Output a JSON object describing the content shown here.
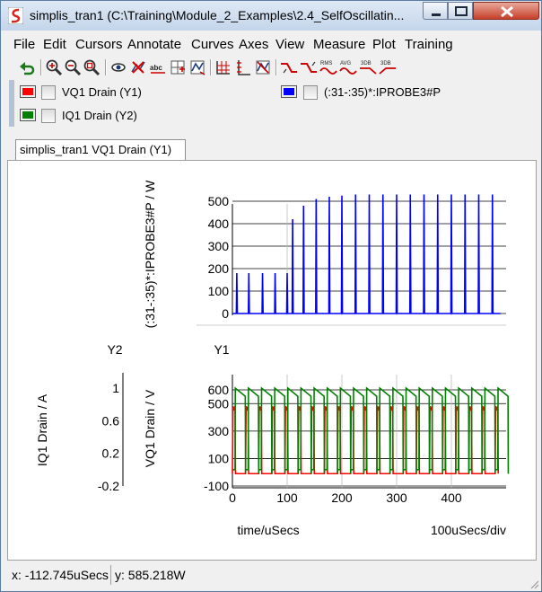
{
  "window": {
    "title": "simplis_tran1 (C:\\Training\\Module_2_Examples\\2.4_SelfOscillatin..."
  },
  "menu": [
    "File",
    "Edit",
    "Cursors",
    "Annotate",
    "Curves",
    "Axes",
    "View",
    "Measure",
    "Plot",
    "Training"
  ],
  "toolbar": {
    "icons": [
      "undo-icon",
      "zoom-in-icon",
      "zoom-out-icon",
      "zoom-fit-icon",
      "show-icon",
      "delete-icon",
      "abc-label-icon",
      "add-grid-icon",
      "add-curve-icon",
      "grid-icon",
      "split-icon",
      "fourier-icon",
      "rise-icon",
      "fall-icon",
      "rms-icon",
      "avg-icon",
      "3db-high-icon",
      "3db-low-icon"
    ],
    "labels": {
      "rms": "RMS",
      "avg": "AVG",
      "db1": "3DB",
      "db2": "3DB"
    }
  },
  "legend": {
    "items": [
      {
        "label": "VQ1 Drain (Y1)",
        "color": "#ff0000"
      },
      {
        "label": "IQ1 Drain (Y2)",
        "color": "#008000"
      },
      {
        "label": "(:31-:35)*:IPROBE3#P",
        "color": "#0000ff"
      }
    ]
  },
  "tabs": [
    {
      "label": "simplis_tran1 VQ1 Drain (Y1)"
    }
  ],
  "plot": {
    "top": {
      "ylabel": "(:31-:35)*:IPROBE3#P / W",
      "yticks": [
        "500",
        "400",
        "300",
        "200",
        "100",
        "0"
      ],
      "color": "#0000ff"
    },
    "bottom": {
      "y1_title": "Y1",
      "y2_title": "Y2",
      "y1_label": "VQ1 Drain / V",
      "y2_label": "IQ1 Drain / A",
      "y1_ticks": [
        "600",
        "500",
        "300",
        "100",
        "-100"
      ],
      "y2_ticks": [
        "1",
        "0.6",
        "0.2",
        "-0.2"
      ],
      "xticks": [
        "0",
        "100",
        "200",
        "300",
        "400"
      ],
      "xlabel": "time/uSecs",
      "xscale_label": "100uSecs/div",
      "colors": {
        "vdrain": "#ff0000",
        "idrain": "#008000"
      }
    }
  },
  "status": {
    "x": "x: -112.745uSecs",
    "y": "y: 585.218W"
  },
  "chart_data": [
    {
      "type": "line",
      "series": [
        {
          "name": "(:31-:35)*:IPROBE3#P",
          "points": [
            [
              0,
              0
            ],
            [
              8,
              180
            ],
            [
              30,
              180
            ],
            [
              55,
              180
            ],
            [
              78,
              180
            ],
            [
              100,
              180
            ],
            [
              110,
              420
            ],
            [
              130,
              480
            ],
            [
              153,
              510
            ],
            [
              177,
              520
            ],
            [
              200,
              525
            ],
            [
              225,
              530
            ],
            [
              250,
              530
            ],
            [
              275,
              530
            ],
            [
              300,
              530
            ],
            [
              325,
              530
            ],
            [
              350,
              530
            ],
            [
              375,
              530
            ],
            [
              400,
              530
            ],
            [
              425,
              530
            ],
            [
              450,
              530
            ],
            [
              475,
              530
            ],
            [
              490,
              0
            ]
          ]
        }
      ],
      "xlim": [
        0,
        500
      ],
      "ylim": [
        0,
        550
      ],
      "ylabel": "(:31-:35)*:IPROBE3#P / W",
      "grid": true
    },
    {
      "type": "line",
      "series": [
        {
          "name": "VQ1 Drain",
          "axis": "Y1",
          "period_us": 24,
          "high_v": 480,
          "low_v": -10,
          "duty_high": 0.8
        },
        {
          "name": "IQ1 Drain",
          "axis": "Y2",
          "period_us": 24,
          "peak_a": 1.0,
          "low_a": -0.05
        }
      ],
      "xlim": [
        0,
        500
      ],
      "y1lim": [
        -100,
        650
      ],
      "y2lim": [
        -0.2,
        1.0
      ],
      "xlabel": "time/uSecs",
      "y1label": "VQ1 Drain / V",
      "y2label": "IQ1 Drain / A",
      "grid": true
    }
  ]
}
